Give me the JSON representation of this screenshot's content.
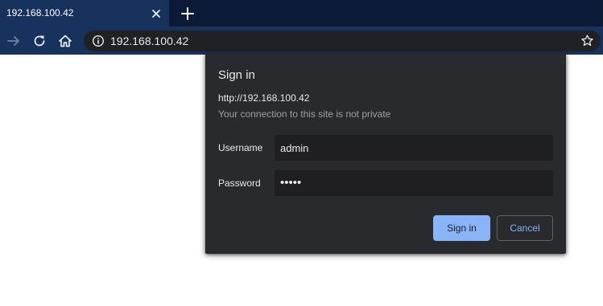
{
  "tab": {
    "title": "192.168.100.42",
    "close_icon": "close-icon",
    "new_tab_icon": "plus-icon"
  },
  "toolbar": {
    "icons": [
      "forward-arrow-icon",
      "reload-icon",
      "home-icon",
      "info-icon",
      "star-icon"
    ],
    "url": "192.168.100.42"
  },
  "dialog": {
    "title": "Sign in",
    "origin": "http://192.168.100.42",
    "warning": "Your connection to this site is not private",
    "username_label": "Username",
    "username_value": "admin",
    "password_label": "Password",
    "password_value": "•••••",
    "sign_in_label": "Sign in",
    "cancel_label": "Cancel"
  },
  "colors": {
    "tabstrip": "#0b1a36",
    "toolbar": "#17325c",
    "dialog": "#292a2d",
    "primary_button": "#8ab4f8"
  }
}
